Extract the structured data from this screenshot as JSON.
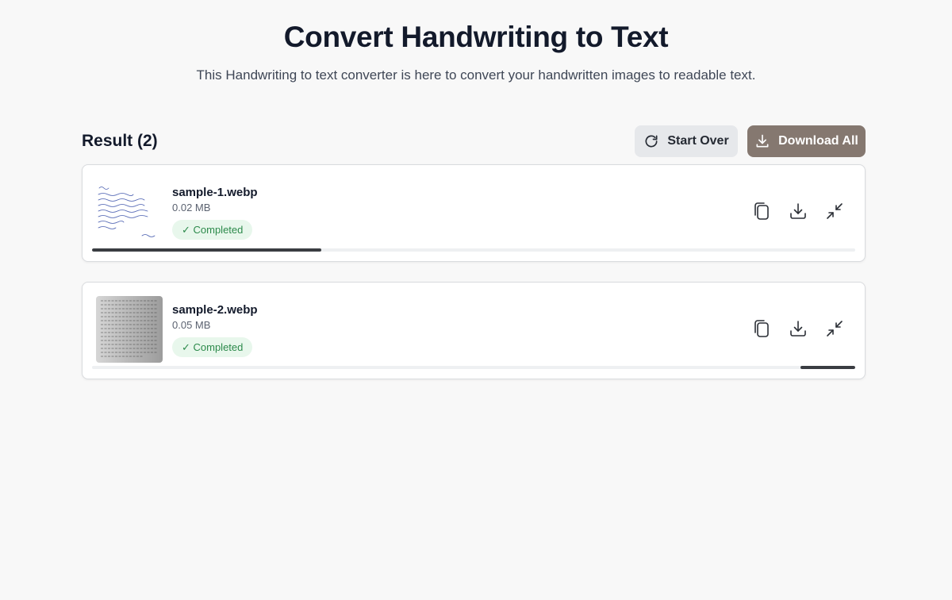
{
  "header": {
    "title": "Convert Handwriting to Text",
    "subtitle": "This Handwriting to text converter is here to convert your handwritten images to readable text."
  },
  "results": {
    "heading": "Result (2)",
    "start_over_label": "Start Over",
    "download_all_label": "Download All",
    "files": [
      {
        "name": "sample-1.webp",
        "size": "0.02 MB",
        "status": "✓ Completed",
        "progress_start": 0,
        "progress_end": 0.3,
        "icons": [
          "copy-icon",
          "download-icon",
          "collapse-icon"
        ]
      },
      {
        "name": "sample-2.webp",
        "size": "0.05 MB",
        "status": "✓ Completed",
        "progress_start": 0.928,
        "progress_end": 1.0,
        "icons": [
          "copy-icon",
          "download-icon",
          "collapse-icon"
        ]
      }
    ]
  },
  "colors": {
    "download_all_bg": "#857870",
    "start_over_bg": "#e6e8eb",
    "status_bg": "#e8f7ec",
    "status_text": "#2c8a4b",
    "progress_fill": "#3a3d42"
  }
}
